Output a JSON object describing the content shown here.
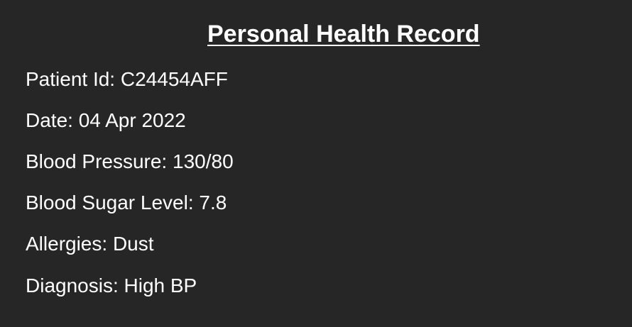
{
  "document": {
    "title": "Personal Health Record",
    "fields": [
      {
        "label": "Patient Id:",
        "value": "C24454AFF"
      },
      {
        "label": "Date:",
        "value": "04 Apr 2022"
      },
      {
        "label": "Blood Pressure:",
        "value": "130/80"
      },
      {
        "label": "Blood Sugar Level:",
        "value": "7.8"
      },
      {
        "label": "Allergies:",
        "value": "Dust"
      },
      {
        "label": "Diagnosis:",
        "value": "High BP"
      }
    ]
  },
  "colors": {
    "background": "#262626",
    "text": "#ffffff"
  }
}
